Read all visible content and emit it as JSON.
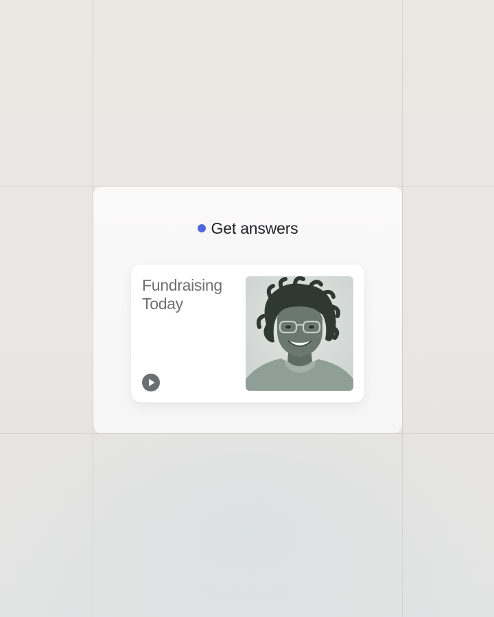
{
  "header": {
    "title": "Get answers",
    "indicator_color": "#5066dc"
  },
  "card": {
    "title": "Fundraising Today",
    "play_icon": "play-icon",
    "photo": "portrait-photo"
  }
}
